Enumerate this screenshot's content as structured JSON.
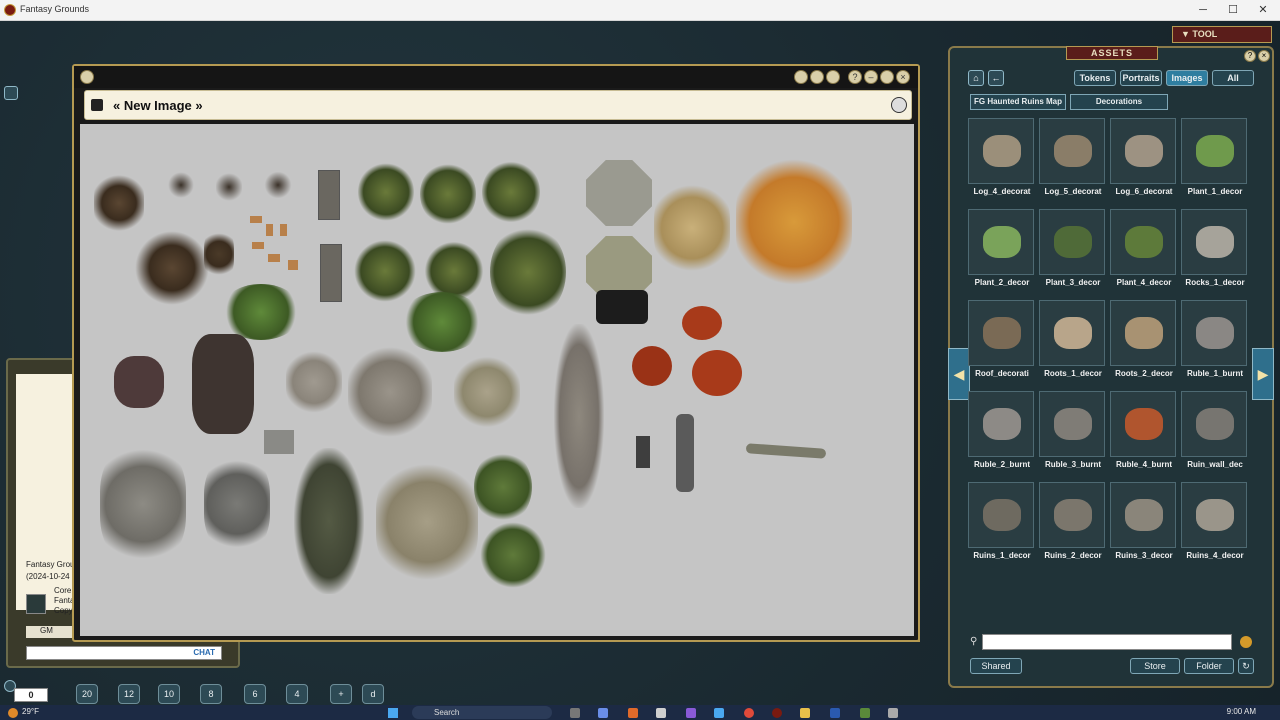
{
  "window": {
    "title": "Fantasy Grounds"
  },
  "image_window": {
    "title": "« New Image »"
  },
  "chat": {
    "lines": [
      "Fantasy Grou",
      "(2024-10-24",
      "Core",
      "Fanta",
      "Copy"
    ],
    "gm_label": "GM",
    "chat_label": "CHAT"
  },
  "tool_button": "TOOL",
  "assets": {
    "title": "ASSETS",
    "tabs": [
      "Tokens",
      "Portraits",
      "Images",
      "All"
    ],
    "active_tab": "Images",
    "breadcrumbs": [
      "FG Haunted Ruins Map",
      "Decorations"
    ],
    "items": [
      {
        "label": "Log_4_decorat",
        "color": "#9b8f7a"
      },
      {
        "label": "Log_5_decorat",
        "color": "#8a7d68"
      },
      {
        "label": "Log_6_decorat",
        "color": "#9d9282"
      },
      {
        "label": "Plant_1_decor",
        "color": "#6f9a4c"
      },
      {
        "label": "Plant_2_decor",
        "color": "#7aa35a"
      },
      {
        "label": "Plant_3_decor",
        "color": "#4f6a38"
      },
      {
        "label": "Plant_4_decor",
        "color": "#5d7a3a"
      },
      {
        "label": "Rocks_1_decor",
        "color": "#a6a39a"
      },
      {
        "label": "Roof_decorati",
        "color": "#7a6a55"
      },
      {
        "label": "Roots_1_decor",
        "color": "#b8a58a"
      },
      {
        "label": "Roots_2_decor",
        "color": "#a89272"
      },
      {
        "label": "Ruble_1_burnt",
        "color": "#8a8784"
      },
      {
        "label": "Ruble_2_burnt",
        "color": "#8d8a86"
      },
      {
        "label": "Ruble_3_burnt",
        "color": "#7f7c76"
      },
      {
        "label": "Ruble_4_burnt",
        "color": "#b0552e"
      },
      {
        "label": "Ruin_wall_dec",
        "color": "#777570"
      },
      {
        "label": "Ruins_1_decor",
        "color": "#6e6a60"
      },
      {
        "label": "Ruins_2_decor",
        "color": "#7b766c"
      },
      {
        "label": "Ruins_3_decor",
        "color": "#8a857a"
      },
      {
        "label": "Ruins_4_decor",
        "color": "#9a958a"
      }
    ],
    "buttons": {
      "shared": "Shared",
      "store": "Store",
      "folder": "Folder"
    }
  },
  "hotbar": {
    "counter": "0",
    "dice": [
      "20",
      "12",
      "10",
      "8",
      "6",
      "4",
      "+",
      "d"
    ]
  },
  "taskbar": {
    "weather": "29°F",
    "search": "Search",
    "time": "9:00 AM"
  }
}
